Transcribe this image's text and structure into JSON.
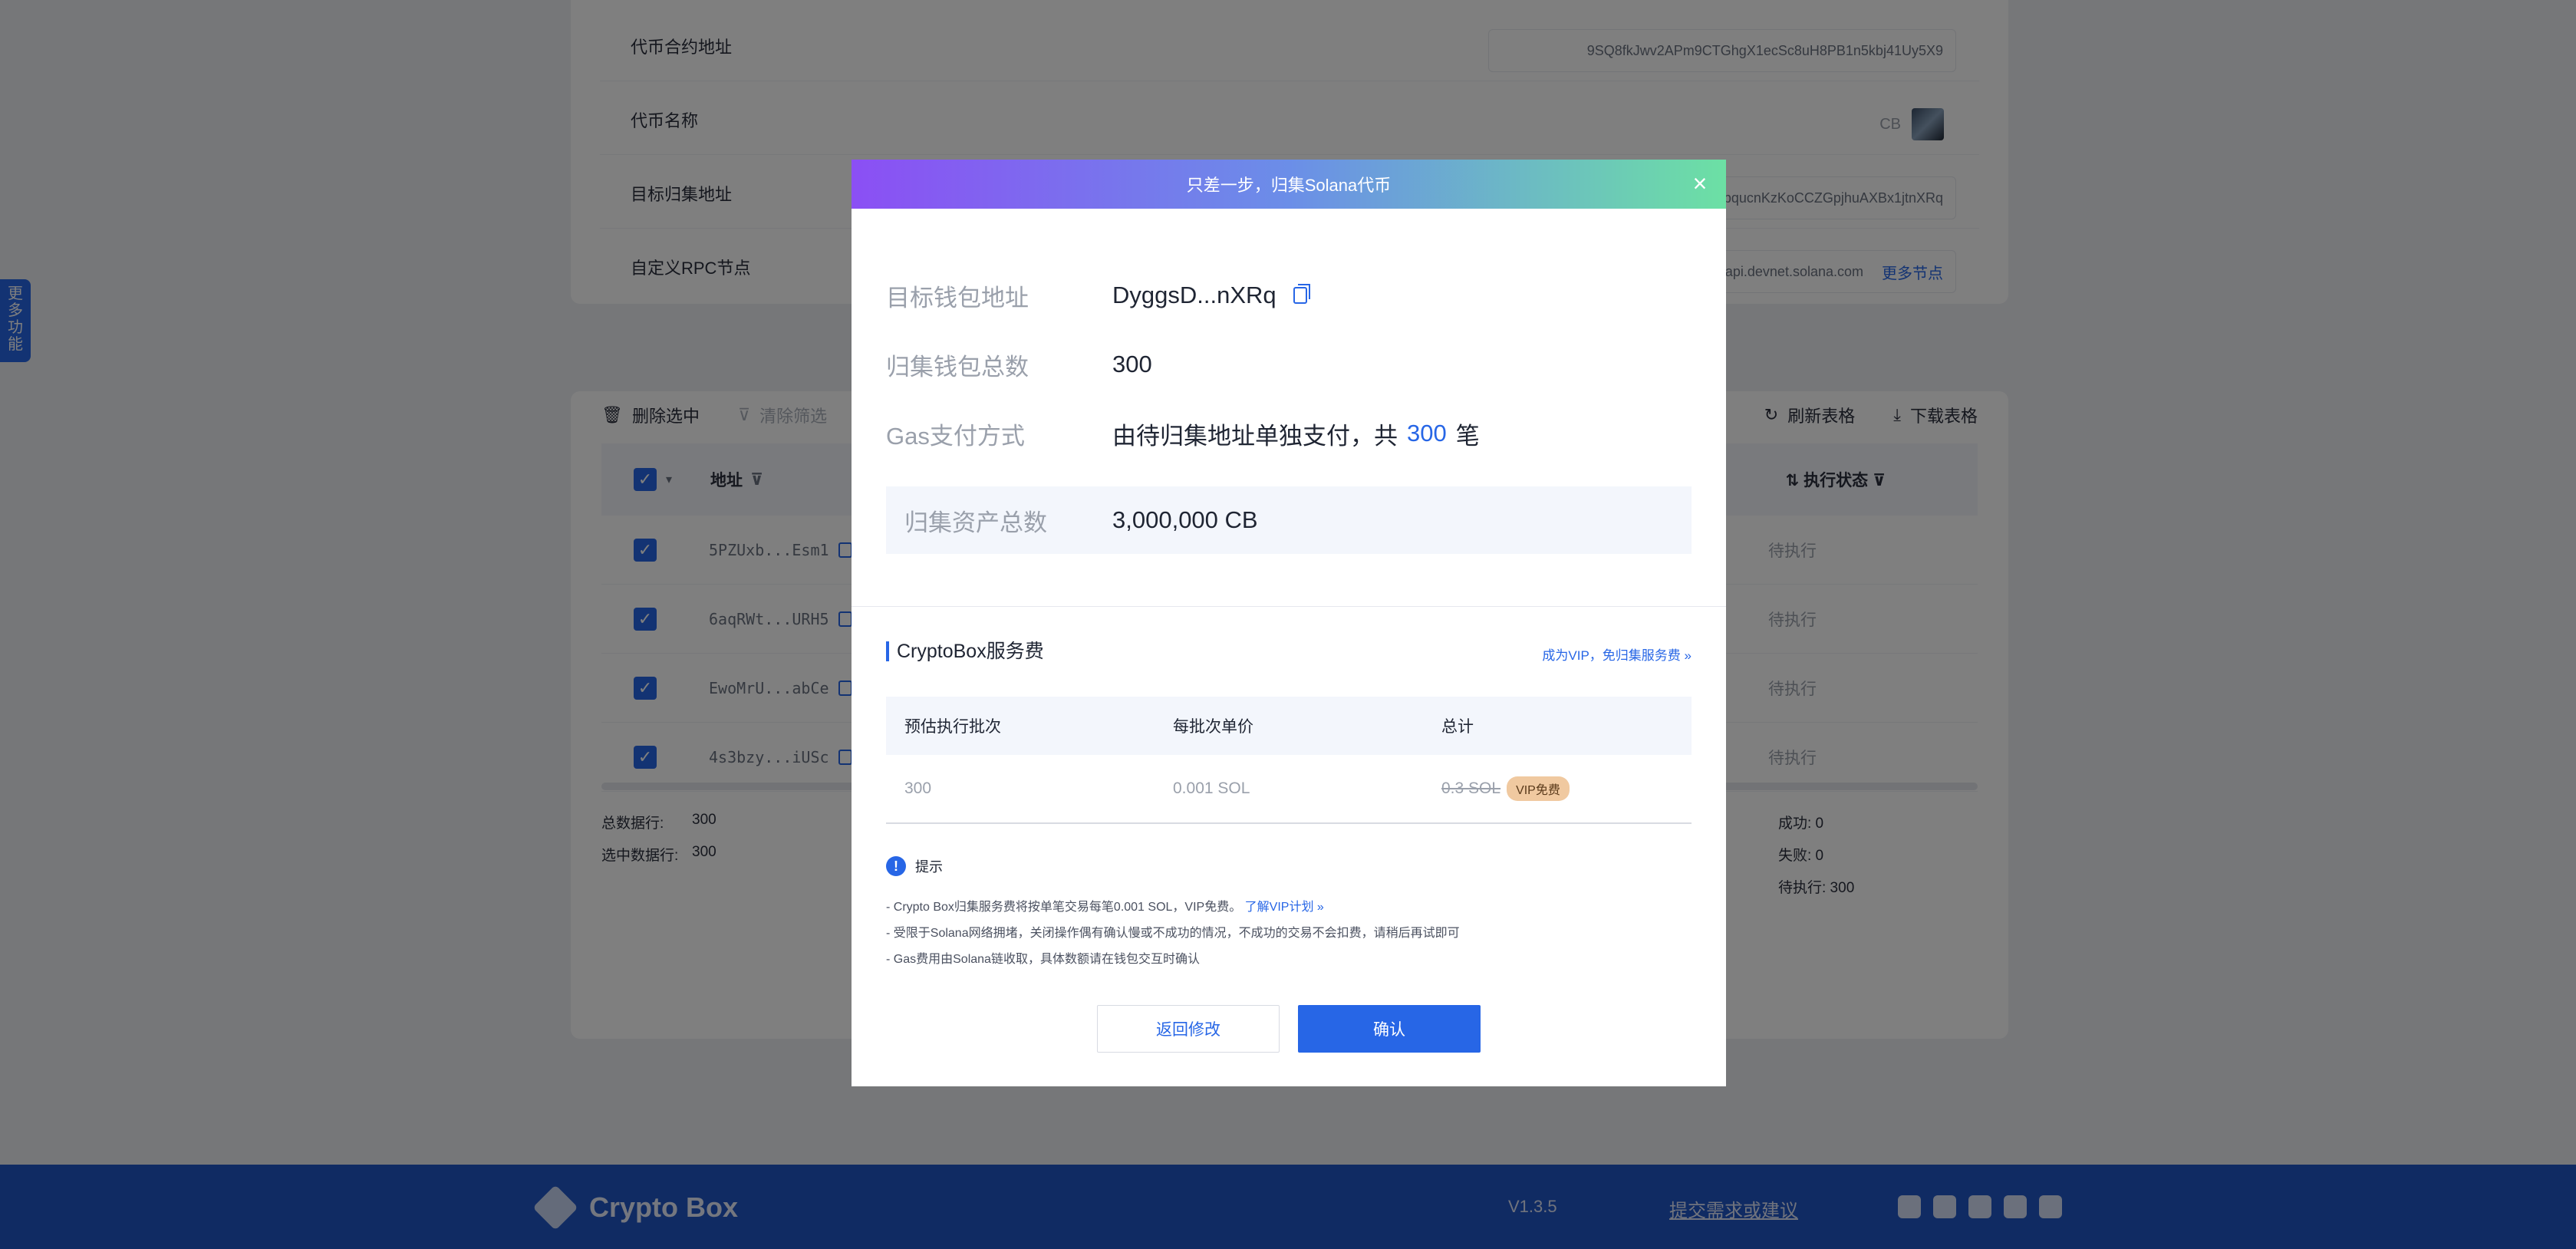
{
  "settings": {
    "contract_label": "代币合约地址",
    "contract_value": "9SQ8fkJwv2APm9CTGhgX1ecSc8uH8PB1n5kbj41Uy5X9",
    "name_label": "代币名称",
    "name_value": "CB",
    "target_label": "目标归集地址",
    "target_value": "bqucnKzKoCCZGpjhuAXBx1jtnXRq",
    "rpc_label": "自定义RPC节点",
    "rpc_value": "/api.devnet.solana.com",
    "rpc_more": "更多节点"
  },
  "side_tab": "更多功能",
  "toolbar": {
    "delete_selected": "删除选中",
    "clear_filter": "清除筛选",
    "refresh": "刷新表格",
    "download": "下载表格"
  },
  "table": {
    "col_address": "地址",
    "col_status": "执行状态",
    "rows": [
      {
        "address": "5PZUxb...Esm1",
        "status": "待执行"
      },
      {
        "address": "6aqRWt...URH5",
        "status": "待执行"
      },
      {
        "address": "EwoMrU...abCe",
        "status": "待执行"
      },
      {
        "address": "4s3bzy...iUSc",
        "status": "待执行"
      }
    ]
  },
  "stats": {
    "total_label": "总数据行:",
    "total_value": "300",
    "selected_label": "选中数据行:",
    "selected_value": "300",
    "success": "成功: 0",
    "fail": "失败: 0",
    "pending": "待执行: 300"
  },
  "footer": {
    "brand": "Crypto Box",
    "version": "V1.3.5",
    "feedback": "提交需求或建议"
  },
  "modal": {
    "title": "只差一步，归集Solana代币",
    "wallet_label": "目标钱包地址",
    "wallet_value": "DyggsD...nXRq",
    "count_label": "归集钱包总数",
    "count_value": "300",
    "gas_label": "Gas支付方式",
    "gas_prefix": "由待归集地址单独支付，共",
    "gas_count": "300",
    "gas_suffix": "笔",
    "total_label": "归集资产总数",
    "total_value": "3,000,000 CB",
    "fee_title": "CryptoBox服务费",
    "vip_link": "成为VIP，免归集服务费 »",
    "fee_headers": [
      "预估执行批次",
      "每批次单价",
      "总计"
    ],
    "fee_batches": "300",
    "fee_unit_price": "0.001 SOL",
    "fee_total": "0.3 SOL",
    "vip_badge": "VIP免费",
    "tip_title": "提示",
    "tip1": "- Crypto Box归集服务费将按单笔交易每笔0.001 SOL，VIP免费。",
    "tip1_link": "了解VIP计划 »",
    "tip2": "- 受限于Solana网络拥堵，关闭操作偶有确认慢或不成功的情况，不成功的交易不会扣费，请稍后再试即可",
    "tip3": "- Gas费用由Solana链收取，具体数额请在钱包交互时确认",
    "btn_back": "返回修改",
    "btn_confirm": "确认"
  }
}
